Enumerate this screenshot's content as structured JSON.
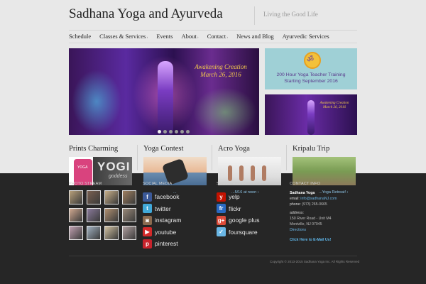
{
  "header": {
    "title": "Sadhana Yoga and Ayurveda",
    "tagline": "Living the Good Life"
  },
  "nav": [
    {
      "label": "Schedule",
      "caret": false
    },
    {
      "label": "Classes & Services",
      "caret": true
    },
    {
      "label": "Events",
      "caret": false
    },
    {
      "label": "About",
      "caret": true
    },
    {
      "label": "Contact",
      "caret": true
    },
    {
      "label": "News and Blog",
      "caret": false
    },
    {
      "label": "Ayurvedic Services",
      "caret": false
    }
  ],
  "hero": {
    "caption_line1": "Awakening Creation",
    "caption_line2": "March 26, 2016",
    "slide_count": 6,
    "active_slide": 1
  },
  "promos": {
    "teacher_training_line1": "200 Hour Yoga Teacher Training",
    "teacher_training_line2": "Starting September 2016",
    "mini_caption_line1": "Awakening Creation",
    "mini_caption_line2": "March 26, 2016"
  },
  "features": [
    {
      "title": "Prints Charming",
      "image_text_1": "YOGA",
      "image_text_2": "YOGI",
      "image_text_3": "goddess"
    },
    {
      "title": "Yoga Contest"
    },
    {
      "title": "Acro Yoga"
    },
    {
      "title": "Kripalu Trip"
    }
  ],
  "footer": {
    "photo_stream_label": "PHOTO STREAM",
    "social_media_label": "SOCIAL MEDIA",
    "social_media_label2": "SOCIAL MEDIA",
    "contact_info_label": "CONTACT INFO",
    "overlay_link_1": "...",
    "overlay_link_2": "...5/16 at noon ›",
    "overlay_link_3": "...Yoga Retreat! ›",
    "social_col1": [
      {
        "label": "facebook",
        "icon": "facebook-icon",
        "glyph": "f",
        "color": "#3b5998"
      },
      {
        "label": "twitter",
        "icon": "twitter-icon",
        "glyph": "t",
        "color": "#41a9d9"
      },
      {
        "label": "instagram",
        "icon": "instagram-icon",
        "glyph": "◙",
        "color": "#8a6a4f"
      },
      {
        "label": "youtube",
        "icon": "youtube-icon",
        "glyph": "▶",
        "color": "#d42a2a"
      },
      {
        "label": "pinterest",
        "icon": "pinterest-icon",
        "glyph": "p",
        "color": "#c8232c"
      }
    ],
    "social_col2": [
      {
        "label": "yelp",
        "icon": "yelp-icon",
        "glyph": "y",
        "color": "#c41200"
      },
      {
        "label": "flickr",
        "icon": "flickr-icon",
        "glyph": "fr",
        "color": "#2a6ac2"
      },
      {
        "label": "google plus",
        "icon": "google-plus-icon",
        "glyph": "g+",
        "color": "#dd4b39"
      },
      {
        "label": "foursquare",
        "icon": "foursquare-icon",
        "glyph": "✓",
        "color": "#6ab7e6"
      }
    ],
    "contact": {
      "name": "Sadhana Yoga",
      "email_label": "email:",
      "email": "info@sadhanaNJ.com",
      "phone_label": "phone:",
      "phone": "(973) 265-0665",
      "address_label": "address:",
      "address_line1": "150 River Road - Unit M4",
      "address_line2": "Montville, NJ 07045",
      "directions": "Directions",
      "email_cta": "Click Here to E-Mail Us!"
    },
    "copyright": "Copyright © 2013-2015 Sadhana Yoga Inc. All Rights Reserved"
  },
  "photo_stream": {
    "thumb_colors": [
      "#b8a07a",
      "#7a6050",
      "#c9b08a",
      "#a08060",
      "#d0a890",
      "#8a7a9a",
      "#b09070",
      "#9a8a7a",
      "#c0a0b0",
      "#a0b0c0",
      "#d0c0a0",
      "#b0a0a0"
    ]
  }
}
